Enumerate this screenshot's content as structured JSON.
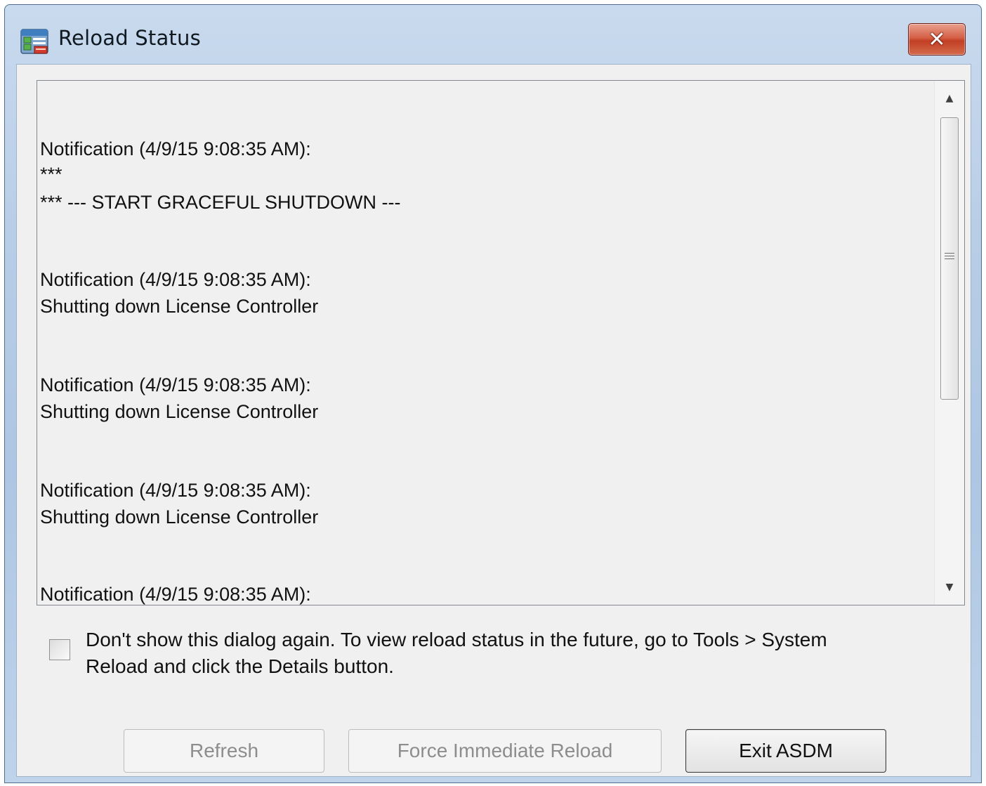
{
  "window": {
    "title": "Reload Status",
    "close_label": "✕"
  },
  "log": {
    "lines": [
      "Notification (4/9/15 9:08:35 AM):",
      "***",
      "*** --- START GRACEFUL SHUTDOWN ---",
      "Notification (4/9/15 9:08:35 AM):",
      "Shutting down License Controller",
      "Notification (4/9/15 9:08:35 AM):",
      "Shutting down License Controller",
      "Notification (4/9/15 9:08:35 AM):",
      "Shutting down License Controller",
      "Notification (4/9/15 9:08:35 AM):"
    ]
  },
  "options": {
    "dont_show_checked": false,
    "dont_show_label_line1": "Don't show this dialog again. To view reload status in the future, go to Tools > System",
    "dont_show_label_line2": "Reload and click the Details button."
  },
  "buttons": {
    "refresh": "Refresh",
    "force_reload": "Force Immediate Reload",
    "exit": "Exit ASDM"
  }
}
